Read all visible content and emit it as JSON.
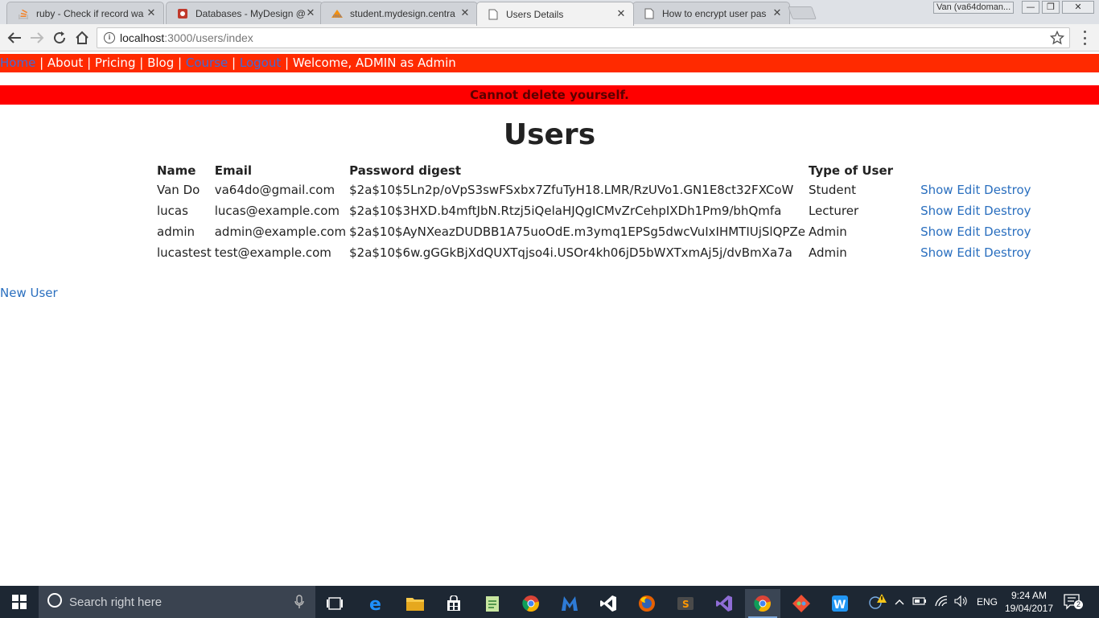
{
  "browser": {
    "tabs": [
      {
        "title": "ruby - Check if record wa",
        "icon": "stackoverflow-icon",
        "active": false
      },
      {
        "title": "Databases - MyDesign @",
        "icon": "database-icon",
        "active": false
      },
      {
        "title": "student.mydesign.centra",
        "icon": "phpmyadmin-icon",
        "active": false
      },
      {
        "title": "Users Details",
        "icon": "page-icon",
        "active": true
      },
      {
        "title": "How to encrypt user pas",
        "icon": "page-icon",
        "active": false
      }
    ],
    "profile_label": "Van (va64doman...",
    "url_host": "localhost",
    "url_path": ":3000/users/index"
  },
  "site_nav": {
    "home": "Home",
    "about": "About",
    "pricing": "Pricing",
    "blog": "Blog",
    "course": "Course",
    "logout": "Logout",
    "separator": "|",
    "welcome": "Welcome, ADMIN as Admin"
  },
  "flash": "Cannot delete yourself.",
  "page_title": "Users",
  "table": {
    "headers": [
      "Name",
      "Email",
      "Password digest",
      "Type of User"
    ],
    "rows": [
      {
        "name": "Van Do",
        "email": "va64do@gmail.com",
        "digest": "$2a$10$5Ln2p/oVpS3swFSxbx7ZfuTyH18.LMR/RzUVo1.GN1E8ct32FXCoW",
        "type": "Student"
      },
      {
        "name": "lucas",
        "email": "lucas@example.com",
        "digest": "$2a$10$3HXD.b4mftJbN.Rtzj5iQelaHJQgICMvZrCehpIXDh1Pm9/bhQmfa",
        "type": "Lecturer"
      },
      {
        "name": "admin",
        "email": "admin@example.com",
        "digest": "$2a$10$AyNXeazDUDBB1A75uoOdE.m3ymq1EPSg5dwcVuIxIHMTIUjSlQPZe",
        "type": "Admin"
      },
      {
        "name": "lucastest",
        "email": "test@example.com",
        "digest": "$2a$10$6w.gGGkBjXdQUXTqjso4i.USOr4kh06jD5bWXTxmAj5j/dvBmXa7a",
        "type": "Admin"
      }
    ],
    "actions": {
      "show": "Show",
      "edit": "Edit",
      "destroy": "Destroy"
    }
  },
  "new_user_link": "New User",
  "taskbar": {
    "search_placeholder": "Search right here",
    "language": "ENG",
    "time": "9:24 AM",
    "date": "19/04/2017",
    "notification_count": "2"
  },
  "colors": {
    "nav_bg": "#ff2a00",
    "flash_bg": "#ff0000",
    "link": "#2a6fbf"
  }
}
